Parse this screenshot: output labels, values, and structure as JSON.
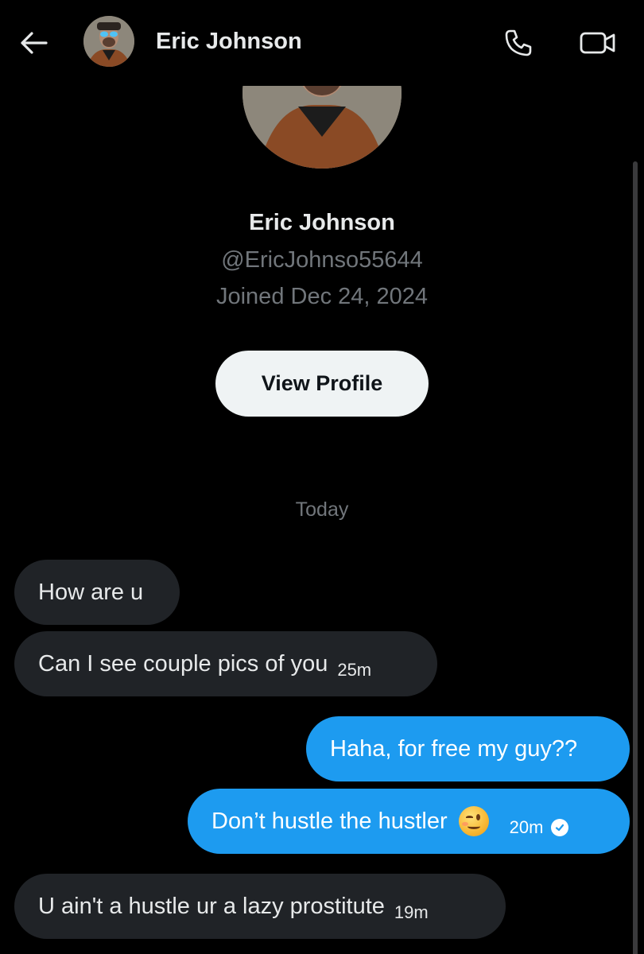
{
  "header": {
    "contact_name": "Eric Johnson",
    "back_icon": "arrow-left-icon",
    "call_icon": "phone-icon",
    "video_icon": "video-camera-icon"
  },
  "profile": {
    "name": "Eric Johnson",
    "handle": "@EricJohnso55644",
    "joined": "Joined Dec 24, 2024",
    "view_profile_label": "View Profile"
  },
  "conversation": {
    "date_divider": "Today",
    "messages": [
      {
        "direction": "incoming",
        "text": "How are u",
        "time": ""
      },
      {
        "direction": "incoming",
        "text": "Can I see couple pics of you",
        "time": "25m"
      },
      {
        "direction": "outgoing",
        "text": "Haha, for free my guy??",
        "time": ""
      },
      {
        "direction": "outgoing",
        "text": "Don’t hustle the hustler",
        "emoji": "winking-face-emoji",
        "time": "20m",
        "status_icon": "sent-check-icon"
      },
      {
        "direction": "incoming",
        "text": "U ain't a hustle ur a lazy prostitute",
        "time": "19m"
      }
    ]
  },
  "colors": {
    "background": "#000000",
    "incoming_bubble": "#202327",
    "outgoing_bubble": "#1d9bf0",
    "secondary_text": "#71767b",
    "primary_text": "#e7e9ea",
    "button_bg": "#eff3f4"
  }
}
